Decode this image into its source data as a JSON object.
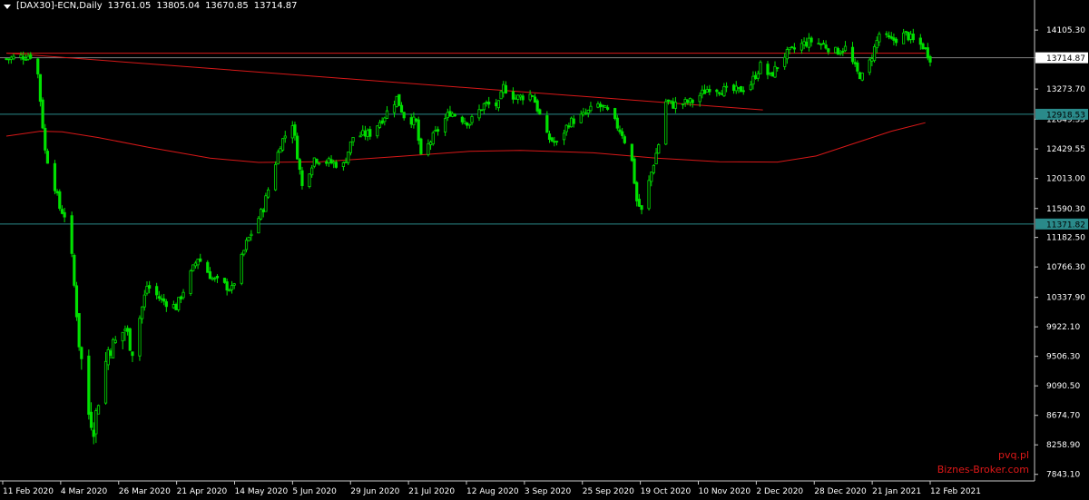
{
  "header": {
    "symbol": "[DAX30]-ECN,Daily",
    "open": "13761.05",
    "high": "13805.04",
    "low": "13670.85",
    "close": "13714.87"
  },
  "watermark": {
    "line1": "pvq.pl",
    "line2": "Biznes-Broker.com"
  },
  "colors": {
    "background": "#000000",
    "candle": "#00e000",
    "trendline": "#d81818",
    "moving_average": "#d81818",
    "hline": "#2a8a8a",
    "price_label_bg": "#2a8a8a",
    "current_price_bg": "#ffffff"
  },
  "chart_data": {
    "type": "candlestick",
    "title": "",
    "xlabel": "",
    "ylabel": "",
    "ylim": [
      7750,
      14350
    ],
    "y_ticks": [
      "14105.30",
      "13714.87",
      "13273.70",
      "12849.35",
      "12429.55",
      "12013.00",
      "11590.30",
      "11182.50",
      "10766.30",
      "10337.90",
      "9922.10",
      "9506.30",
      "9090.50",
      "8674.70",
      "8258.90",
      "7843.10"
    ],
    "x_ticks": [
      "11 Feb 2020",
      "4 Mar 2020",
      "26 Mar 2020",
      "21 Apr 2020",
      "14 May 2020",
      "5 Jun 2020",
      "29 Jun 2020",
      "21 Jul 2020",
      "12 Aug 2020",
      "3 Sep 2020",
      "25 Sep 2020",
      "19 Oct 2020",
      "10 Nov 2020",
      "2 Dec 2020",
      "28 Dec 2020",
      "21 Jan 2021",
      "12 Feb 2021"
    ],
    "x_range": [
      "2020-02-11",
      "2021-02-26"
    ],
    "horizontal_lines": [
      {
        "value": 12918.53,
        "label": "12918.53"
      },
      {
        "value": 11371.82,
        "label": "11371.82"
      }
    ],
    "current_price": {
      "value": 13714.87,
      "label": "13714.87"
    },
    "trendlines": [
      {
        "start": [
          "2020-02-11",
          13780
        ],
        "end": [
          "2021-02-24",
          13780
        ]
      },
      {
        "start": [
          "2020-02-11",
          13780
        ],
        "end": [
          "2020-12-19",
          12980
        ]
      }
    ],
    "moving_average": [
      [
        "2020-02-11",
        12610
      ],
      [
        "2020-02-25",
        12680
      ],
      [
        "2020-03-05",
        12670
      ],
      [
        "2020-03-20",
        12590
      ],
      [
        "2020-04-10",
        12450
      ],
      [
        "2020-05-05",
        12300
      ],
      [
        "2020-05-25",
        12240
      ],
      [
        "2020-06-20",
        12250
      ],
      [
        "2020-07-20",
        12320
      ],
      [
        "2020-08-20",
        12395
      ],
      [
        "2020-09-10",
        12410
      ],
      [
        "2020-10-10",
        12375
      ],
      [
        "2020-11-05",
        12300
      ],
      [
        "2020-12-01",
        12250
      ],
      [
        "2020-12-25",
        12245
      ],
      [
        "2021-01-10",
        12330
      ],
      [
        "2021-01-25",
        12500
      ],
      [
        "2021-02-10",
        12680
      ],
      [
        "2021-02-24",
        12800
      ]
    ],
    "price_path": [
      [
        "2020-02-11",
        13700
      ],
      [
        "2020-02-21",
        13750
      ],
      [
        "2020-02-24",
        13480
      ],
      [
        "2020-02-27",
        12400
      ],
      [
        "2020-03-02",
        11900
      ],
      [
        "2020-03-04",
        11600
      ],
      [
        "2020-03-06",
        11500
      ],
      [
        "2020-03-09",
        10900
      ],
      [
        "2020-03-12",
        9700
      ],
      [
        "2020-03-16",
        8700
      ],
      [
        "2020-03-18",
        8500
      ],
      [
        "2020-03-20",
        8900
      ],
      [
        "2020-03-24",
        9600
      ],
      [
        "2020-03-27",
        9700
      ],
      [
        "2020-03-31",
        9900
      ],
      [
        "2020-04-03",
        9600
      ],
      [
        "2020-04-09",
        10500
      ],
      [
        "2020-04-15",
        10300
      ],
      [
        "2020-04-21",
        10200
      ],
      [
        "2020-04-30",
        10900
      ],
      [
        "2020-05-06",
        10600
      ],
      [
        "2020-05-14",
        10450
      ],
      [
        "2020-05-20",
        11100
      ],
      [
        "2020-05-27",
        11600
      ],
      [
        "2020-06-03",
        12500
      ],
      [
        "2020-06-08",
        12800
      ],
      [
        "2020-06-12",
        11900
      ],
      [
        "2020-06-17",
        12300
      ],
      [
        "2020-06-22",
        12250
      ],
      [
        "2020-06-29",
        12200
      ],
      [
        "2020-07-03",
        12600
      ],
      [
        "2020-07-10",
        12650
      ],
      [
        "2020-07-16",
        12900
      ],
      [
        "2020-07-21",
        13150
      ],
      [
        "2020-07-24",
        12900
      ],
      [
        "2020-07-29",
        12800
      ],
      [
        "2020-07-31",
        12300
      ],
      [
        "2020-08-05",
        12600
      ],
      [
        "2020-08-12",
        12950
      ],
      [
        "2020-08-20",
        12800
      ],
      [
        "2020-08-26",
        13050
      ],
      [
        "2020-09-01",
        13050
      ],
      [
        "2020-09-03",
        13300
      ],
      [
        "2020-09-08",
        13150
      ],
      [
        "2020-09-15",
        13200
      ],
      [
        "2020-09-21",
        12600
      ],
      [
        "2020-09-25",
        12500
      ],
      [
        "2020-09-30",
        12800
      ],
      [
        "2020-10-06",
        12900
      ],
      [
        "2020-10-12",
        13050
      ],
      [
        "2020-10-16",
        12950
      ],
      [
        "2020-10-22",
        12650
      ],
      [
        "2020-10-26",
        12250
      ],
      [
        "2020-10-28",
        11700
      ],
      [
        "2020-10-30",
        11550
      ],
      [
        "2020-11-03",
        12100
      ],
      [
        "2020-11-06",
        12500
      ],
      [
        "2020-11-09",
        13100
      ],
      [
        "2020-11-12",
        13050
      ],
      [
        "2020-11-20",
        13100
      ],
      [
        "2020-11-27",
        13300
      ],
      [
        "2020-12-04",
        13250
      ],
      [
        "2020-12-09",
        13250
      ],
      [
        "2020-12-14",
        13350
      ],
      [
        "2020-12-18",
        13600
      ],
      [
        "2020-12-22",
        13450
      ],
      [
        "2020-12-28",
        13750
      ],
      [
        "2021-01-04",
        13900
      ],
      [
        "2021-01-08",
        13950
      ],
      [
        "2021-01-13",
        13900
      ],
      [
        "2021-01-18",
        13800
      ],
      [
        "2021-01-22",
        13850
      ],
      [
        "2021-01-27",
        13500
      ],
      [
        "2021-01-29",
        13450
      ],
      [
        "2021-02-01",
        13650
      ],
      [
        "2021-02-05",
        14050
      ],
      [
        "2021-02-10",
        13950
      ],
      [
        "2021-02-16",
        14050
      ],
      [
        "2021-02-19",
        13950
      ],
      [
        "2021-02-23",
        13880
      ],
      [
        "2021-02-26",
        13715
      ]
    ]
  }
}
